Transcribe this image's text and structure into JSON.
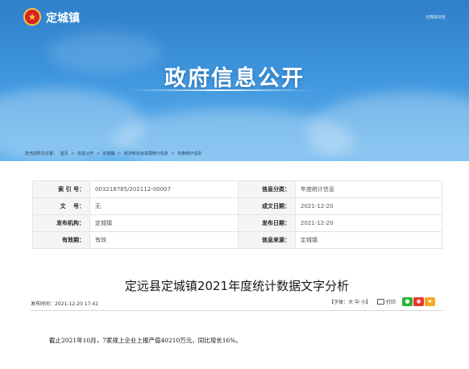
{
  "header": {
    "site_name": "定城镇",
    "emblem_icon": "national-emblem-icon",
    "accessibility_link": "无障碍浏览",
    "banner_title": "政府信息公开"
  },
  "breadcrumb": {
    "prefix": "您当前所在位置：",
    "items": [
      "首页",
      "信息公开",
      "定城镇",
      "经济和社会发展统计信息",
      "年度统计信息"
    ],
    "separator": ">"
  },
  "meta": {
    "rows": [
      [
        {
          "label": "索 引 号：",
          "value": "003218785/202112-00007"
        },
        {
          "label": "信息分类：",
          "value": "年度统计信息"
        }
      ],
      [
        {
          "label": "文　 号：",
          "value": "无"
        },
        {
          "label": "成文日期：",
          "value": "2021-12-20"
        }
      ],
      [
        {
          "label": "发布机构：",
          "value": "定城镇"
        },
        {
          "label": "发布日期：",
          "value": "2021-12-20"
        }
      ],
      [
        {
          "label": "有效期：",
          "value": "有效"
        },
        {
          "label": "信息来源：",
          "value": "定城镇"
        }
      ]
    ]
  },
  "article": {
    "title": "定远县定城镇2021年度统计数据文字分析",
    "publish_label": "发布时间：",
    "publish_time": "2021-12-20 17:41",
    "font_size_label": "【字体：",
    "font_large": "大",
    "font_medium": "中",
    "font_small": "小",
    "font_size_end": "】",
    "print_label": "打印",
    "share_icons": [
      "wechat-icon",
      "weibo-icon",
      "qzone-icon"
    ],
    "body": "截止2021年10月，7家规上企业上报产值40210万元，同比增长16%。"
  },
  "colors": {
    "banner_top": "#2f7fc9",
    "banner_bottom": "#62b3ee",
    "label_bg": "#f5f5f5",
    "border": "#e3e3e3"
  }
}
